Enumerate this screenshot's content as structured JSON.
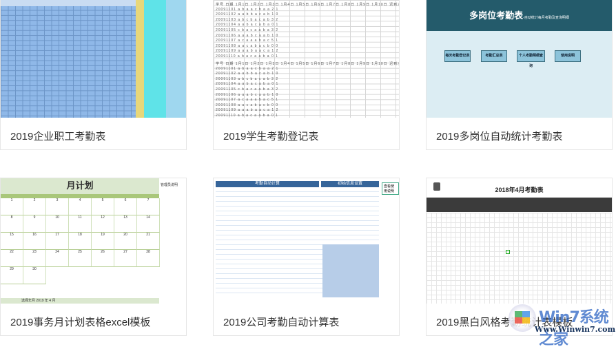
{
  "cards": [
    {
      "title": "2019企业职工考勤表"
    },
    {
      "title": "2019学生考勤登记表"
    },
    {
      "title": "2019多岗位自动统计考勤表",
      "preview": {
        "heading": "多岗位考勤表",
        "subheading": "-自动统计每月考勤及查询明细",
        "buttons": [
          "每天考勤登记表",
          "考勤汇总表",
          "个人考勤明细查询",
          "使用说明"
        ]
      }
    },
    {
      "title": "2019事务月计划表格excel模板",
      "preview": {
        "heading": "月计划",
        "side_note": "管理员说明",
        "footer": "选择年月   2019   年   4   月",
        "days": [
          "1",
          "2",
          "3",
          "4",
          "5",
          "6",
          "7",
          "8",
          "9",
          "10",
          "11",
          "12",
          "13",
          "14",
          "15",
          "16",
          "17",
          "18",
          "19",
          "20",
          "21",
          "22",
          "23",
          "24",
          "25",
          "26",
          "27",
          "28",
          "29",
          "30"
        ]
      }
    },
    {
      "title": "2019公司考勤自动计算表",
      "preview": {
        "heading_left": "考勤自动计算",
        "heading_right": "初始信息设置",
        "side_note": "查看使用说明"
      }
    },
    {
      "title": "2019黑白风格考勤统计表模板",
      "preview": {
        "heading": "2018年4月考勤表"
      }
    }
  ],
  "card2_rows": [
    "学号 日期 1月1日 1月2日 1月3日 1月4日 1月5日 1月6日 1月7日 1月8日 1月9日 1月10日 迟到次数 旷课次数",
    "20091101 a b a a c b a a 2 1",
    "20091102 a a b b a c a b 1 0",
    "20091103 a b c b a c a b 3 2",
    "20091104 a a b a c a b a 0 1",
    "20091105 c b a c a a b a 3 2",
    "20091106 a a a b c a a b 1 0",
    "20091107 a c a a a b a c 5 1",
    "20091108 a a c a b a c b 0 0",
    "20091109 a a a b a a c a 1 2",
    "20091110 a b a c a a b a 0 1"
  ],
  "watermark": {
    "brand": "Win7系统之家",
    "url": "Www.Winwin7.com"
  }
}
